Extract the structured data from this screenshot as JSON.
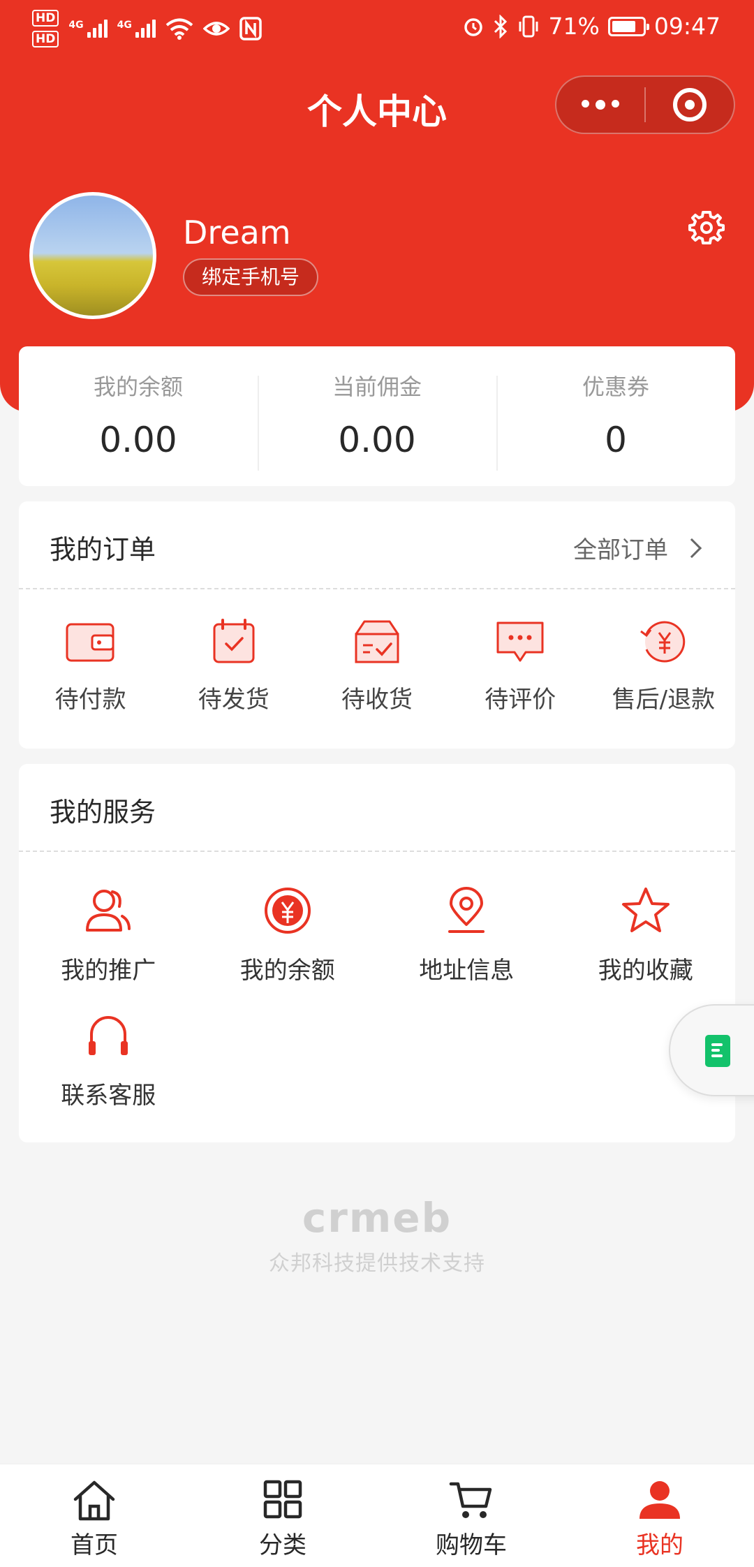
{
  "status_bar": {
    "hd1": "HD",
    "hd2": "HD",
    "net1": "4G",
    "net2": "4G",
    "battery": "71%",
    "time": "09:47"
  },
  "header": {
    "title": "个人中心"
  },
  "user": {
    "name": "Dream",
    "bind_phone": "绑定手机号"
  },
  "stats": [
    {
      "label": "我的余额",
      "value": "0.00"
    },
    {
      "label": "当前佣金",
      "value": "0.00"
    },
    {
      "label": "优惠券",
      "value": "0"
    }
  ],
  "orders": {
    "title": "我的订单",
    "all_label": "全部订单",
    "items": [
      {
        "label": "待付款",
        "icon": "wallet-icon"
      },
      {
        "label": "待发货",
        "icon": "calendar-check-icon"
      },
      {
        "label": "待收货",
        "icon": "box-check-icon"
      },
      {
        "label": "待评价",
        "icon": "comment-icon"
      },
      {
        "label": "售后/退款",
        "icon": "refund-icon"
      }
    ]
  },
  "services": {
    "title": "我的服务",
    "items": [
      {
        "label": "我的推广",
        "icon": "users-icon"
      },
      {
        "label": "我的余额",
        "icon": "coin-icon"
      },
      {
        "label": "地址信息",
        "icon": "location-icon"
      },
      {
        "label": "我的收藏",
        "icon": "star-icon"
      },
      {
        "label": "联系客服",
        "icon": "headset-icon"
      }
    ]
  },
  "footer": {
    "brand": "crmeb",
    "support": "众邦科技提供技术支持"
  },
  "tabbar": [
    {
      "label": "首页",
      "icon": "home-icon"
    },
    {
      "label": "分类",
      "icon": "grid-icon"
    },
    {
      "label": "购物车",
      "icon": "cart-icon"
    },
    {
      "label": "我的",
      "icon": "user-icon",
      "active": true
    }
  ],
  "colors": {
    "accent": "#e93323",
    "background": "#f5f5f5",
    "float_doc": "#13c26b"
  }
}
